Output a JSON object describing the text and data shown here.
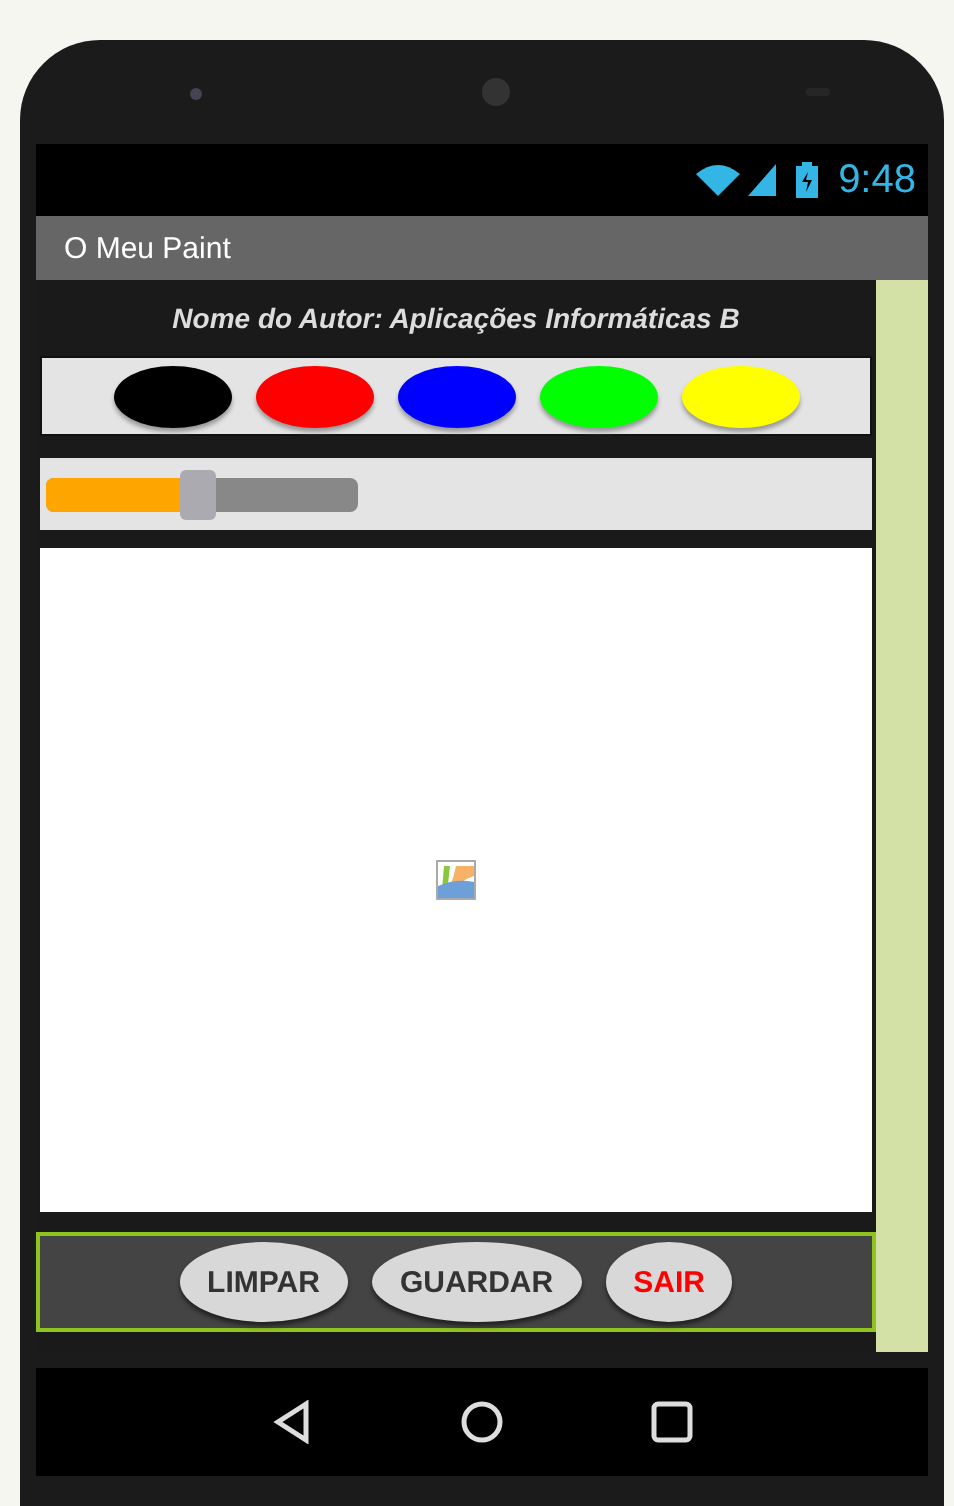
{
  "status_bar": {
    "time": "9:48"
  },
  "title_bar": {
    "title": "O Meu Paint"
  },
  "author_label": "Nome do Autor: Aplicações Informáticas B",
  "color_buttons": [
    {
      "color": "#000000"
    },
    {
      "color": "#ff0000"
    },
    {
      "color": "#0000ff"
    },
    {
      "color": "#00ff00"
    },
    {
      "color": "#ffff00"
    }
  ],
  "slider": {
    "level": 0.5
  },
  "buttons": [
    {
      "label": "LIMPAR",
      "color": "#333333"
    },
    {
      "label": "GUARDAR",
      "color": "#333333"
    },
    {
      "label": "SAIR",
      "color": "#ff0000"
    }
  ]
}
